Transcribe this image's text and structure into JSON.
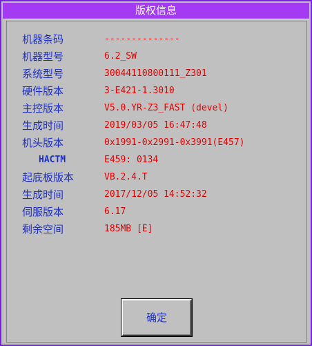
{
  "dialog": {
    "title": "版权信息",
    "ok_label": "确定"
  },
  "rows": [
    {
      "label": "机器条码",
      "value": "--------------"
    },
    {
      "label": "机器型号",
      "value": "6.2_SW"
    },
    {
      "label": "系统型号",
      "value": "30044110800111_Z301"
    },
    {
      "label": "硬件版本",
      "value": "3-E421-1.3010"
    },
    {
      "label": "主控版本",
      "value": "V5.0.YR-Z3_FAST (devel)"
    },
    {
      "label": "生成时间",
      "value": "2019/03/05 16:47:48"
    },
    {
      "label": "机头版本",
      "value": "0x1991-0x2991-0x3991(E457)"
    },
    {
      "label": "HACTM",
      "value": "E459: 0134"
    },
    {
      "label": "起底板版本",
      "value": "VB.2.4.T"
    },
    {
      "label": "生成时间",
      "value": "2017/12/05 14:52:32"
    },
    {
      "label": "伺服版本",
      "value": "6.17"
    },
    {
      "label": "剩余空间",
      "value": "185MB [E]"
    }
  ],
  "colors": {
    "titlebar": "#a33bf2",
    "label": "#1e2fc8",
    "value": "#e60000",
    "background": "#c0c0c0"
  }
}
